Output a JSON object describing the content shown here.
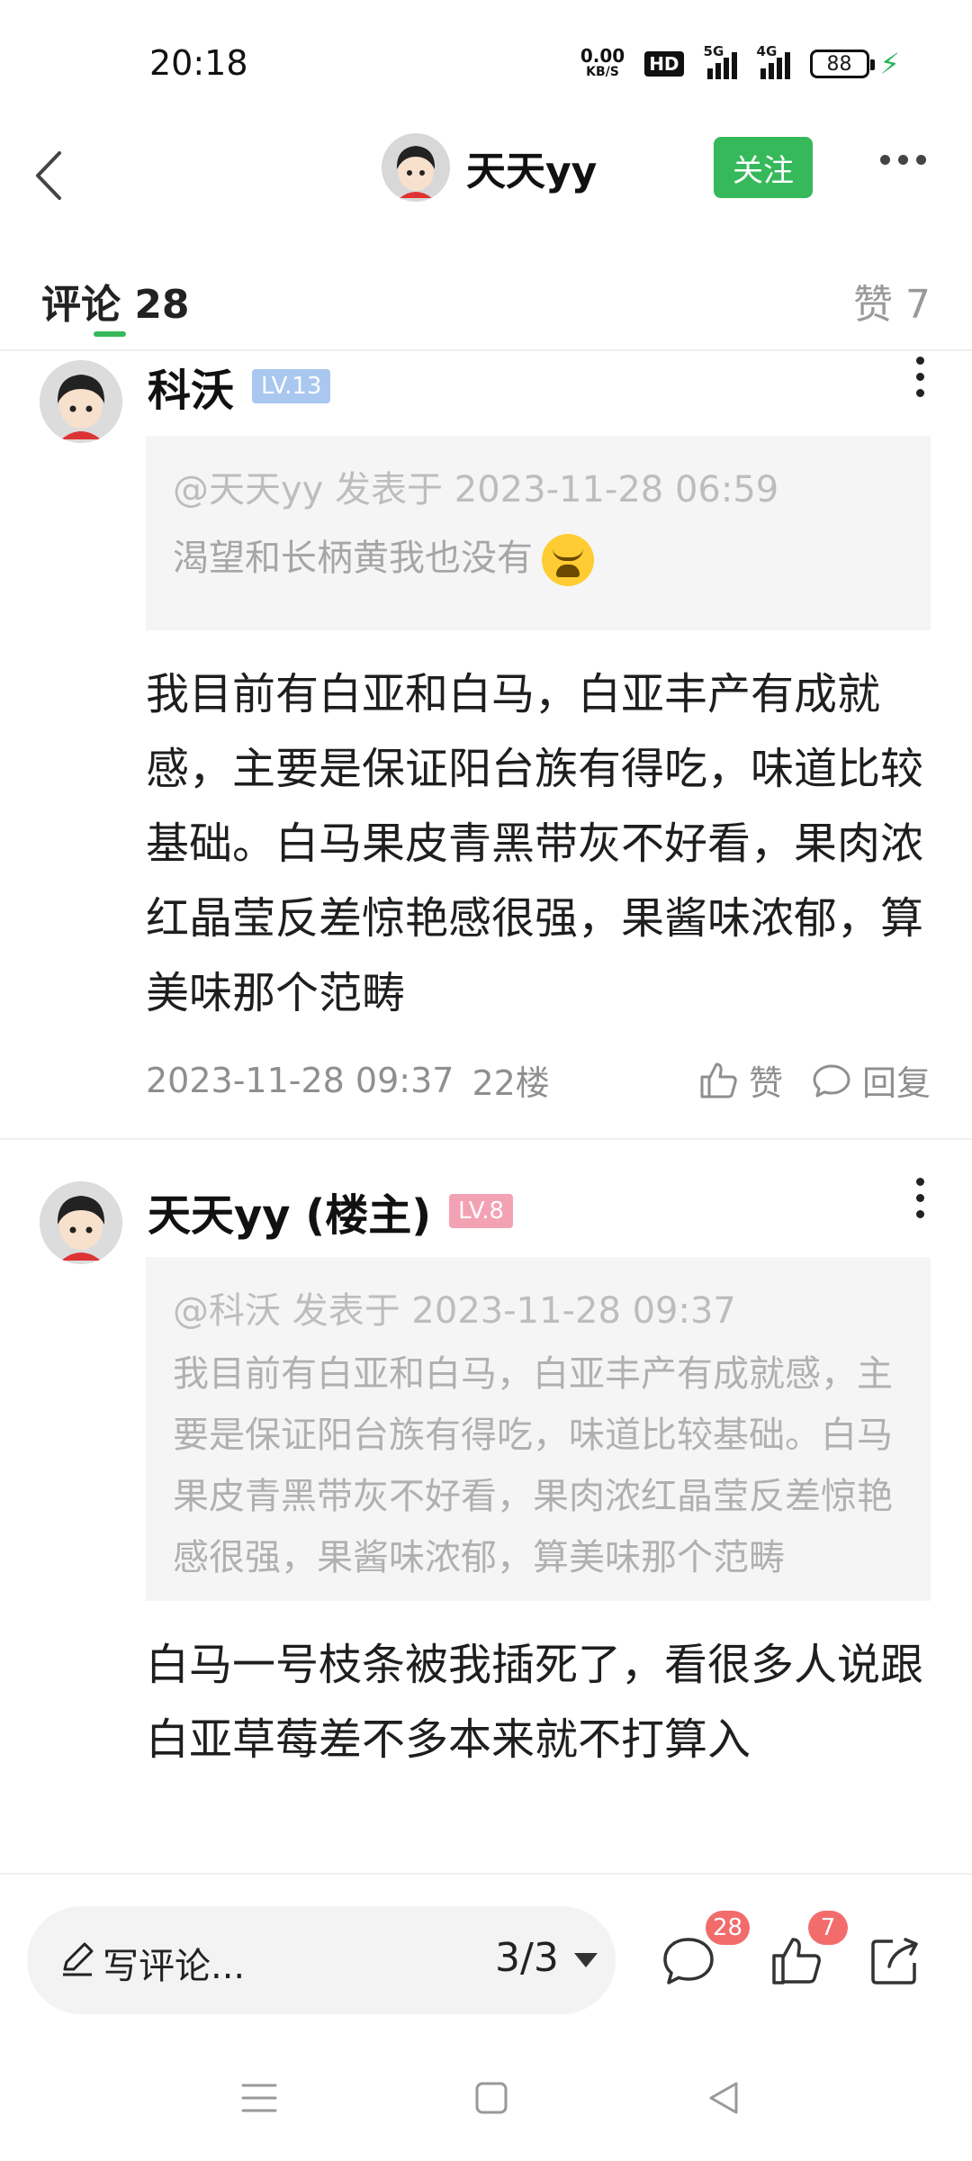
{
  "status_bar": {
    "time": "20:18",
    "net_speed_value": "0.00",
    "net_speed_unit": "KB/S",
    "hd_label": "HD",
    "sim1_gen": "5G",
    "sim2_gen": "4G",
    "battery": "88",
    "charging": true
  },
  "header": {
    "username": "天天yy",
    "follow_label": "关注"
  },
  "tabs": {
    "comments_label": "评论 28",
    "likes_label": "赞 7"
  },
  "comments": [
    {
      "author": "科沃",
      "level": "LV.13",
      "level_color": "#a9c7ef",
      "quote_meta": "@天天yy 发表于 2023-11-28 06:59",
      "quote_text": "渴望和长柄黄我也没有",
      "body": "我目前有白亚和白马，白亚丰产有成就感，主要是保证阳台族有得吃，味道比较基础。白马果皮青黑带灰不好看，果肉浓红晶莹反差惊艳感很强，果酱味浓郁，算美味那个范畴",
      "time": "2023-11-28 09:37",
      "floor": "22楼",
      "like_label": "赞",
      "reply_label": "回复"
    },
    {
      "author": "天天yy (楼主)",
      "level": "LV.8",
      "level_color": "#f3a2b4",
      "quote_meta": "@科沃 发表于 2023-11-28 09:37",
      "quote_text": "我目前有白亚和白马，白亚丰产有成就感，主要是保证阳台族有得吃，味道比较基础。白马果皮青黑带灰不好看，果肉浓红晶莹反差惊艳感很强，果酱味浓郁，算美味那个范畴",
      "body": "白马一号枝条被我插死了，看很多人说跟白亚草莓差不多本来就不打算入"
    }
  ],
  "bottom_bar": {
    "write_label": "写评论...",
    "page_indicator": "3/3",
    "comment_count": "28",
    "like_count": "7"
  },
  "colors": {
    "accent": "#36b95a",
    "badge": "#f26c6c"
  }
}
